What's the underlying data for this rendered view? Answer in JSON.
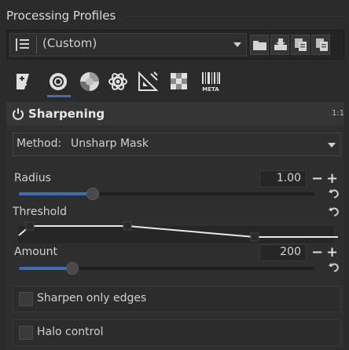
{
  "profiles": {
    "title": "Processing Profiles",
    "selected": "(Custom)",
    "icons": [
      "list-icon",
      "open-folder-icon",
      "paste-icon",
      "copy-icon",
      "paste-partial-icon"
    ]
  },
  "tabs": [
    {
      "icon": "exposure-tab-icon"
    },
    {
      "icon": "detail-tab-icon",
      "active": true
    },
    {
      "icon": "color-tab-icon"
    },
    {
      "icon": "advanced-tab-icon"
    },
    {
      "icon": "transform-tab-icon"
    },
    {
      "icon": "raw-tab-icon"
    },
    {
      "icon": "metadata-tab-icon",
      "label": "META"
    }
  ],
  "tool": {
    "title": "Sharpening",
    "version_badge": "1:1",
    "method_label": "Method:",
    "method_value": "Unsharp Mask",
    "radius": {
      "label": "Radius",
      "value": "1.00",
      "fraction": 0.25
    },
    "threshold": {
      "label": "Threshold"
    },
    "amount": {
      "label": "Amount",
      "value": "200",
      "fraction": 0.18
    },
    "sharpen_edges": {
      "label": "Sharpen only edges",
      "checked": false
    },
    "halo": {
      "label": "Halo control",
      "checked": false
    },
    "minus": "−",
    "plus": "+"
  },
  "colors": {
    "accent": "#3d6fb6",
    "background": "#2b2b2b"
  }
}
